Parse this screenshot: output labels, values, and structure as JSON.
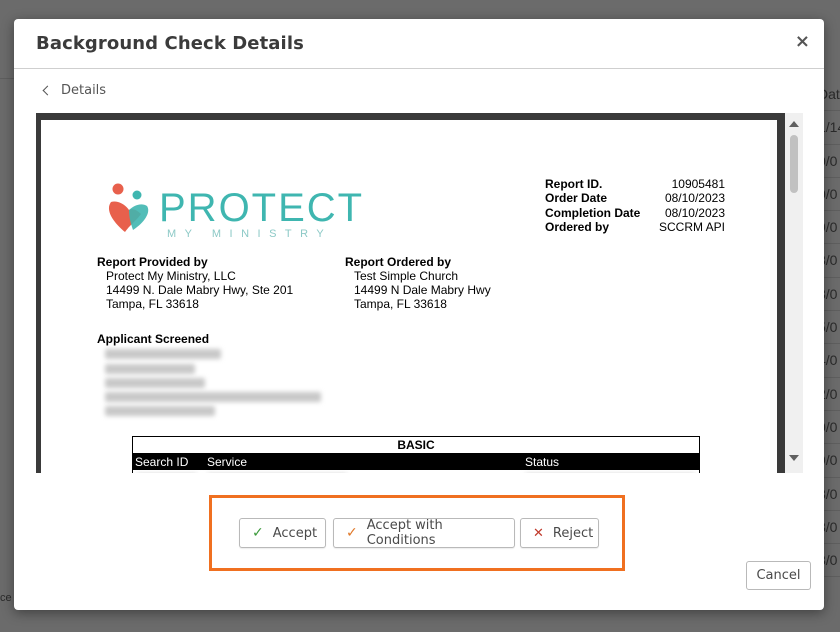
{
  "modal": {
    "title": "Background Check Details",
    "close_glyph": "×",
    "breadcrumb_label": "Details"
  },
  "backdrop": {
    "column_fragments": [
      "Dat",
      "1/14",
      "0/0",
      "0/0",
      "9/0",
      "8/0",
      "8/0",
      "5/0",
      "4/0",
      "2/0",
      "0/0",
      "9/0",
      "8/0",
      "8/0",
      "8/0"
    ],
    "bottom_left_fragment": "ce"
  },
  "report": {
    "logo_word": "PROTECT",
    "logo_sub": "MY MINISTRY",
    "meta": {
      "labels": [
        "Report ID.",
        "Order Date",
        "Completion Date",
        "Ordered by"
      ],
      "values": [
        "10905481",
        "08/10/2023",
        "08/10/2023",
        "SCCRM API"
      ]
    },
    "provided_by": {
      "heading": "Report Provided by",
      "lines": [
        "Protect My Ministry, LLC",
        "14499 N. Dale Mabry Hwy, Ste 201",
        "Tampa, FL 33618"
      ]
    },
    "ordered_by": {
      "heading": "Report Ordered by",
      "lines": [
        "Test Simple Church",
        "14499 N Dale Mabry Hwy",
        "Tampa, FL 33618"
      ]
    },
    "applicant_heading": "Applicant Screened",
    "basic_table": {
      "title": "BASIC",
      "headers": [
        "Search ID",
        "Service",
        "Status"
      ]
    }
  },
  "actions": {
    "accept": "Accept",
    "accept_with_conditions": "Accept with Conditions",
    "reject": "Reject",
    "cancel": "Cancel"
  },
  "colors": {
    "highlight_frame": "#f07020",
    "logo_teal": "#3fb6b0",
    "accept_check": "#3b9a3b",
    "conditions_check": "#e07828",
    "reject_x": "#c0392b"
  }
}
